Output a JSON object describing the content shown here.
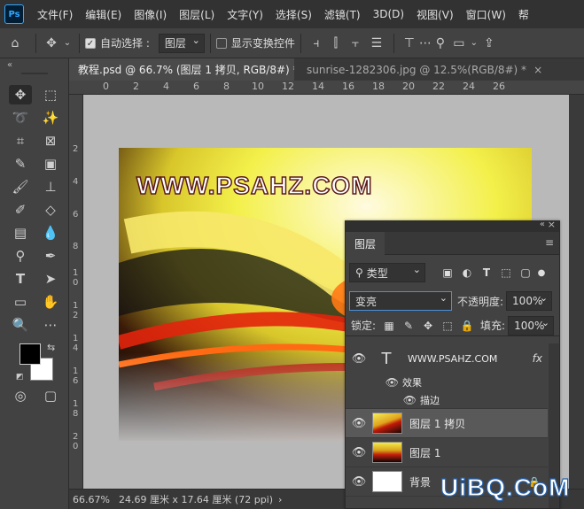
{
  "app": {
    "logo": "Ps"
  },
  "menu": [
    "文件(F)",
    "编辑(E)",
    "图像(I)",
    "图层(L)",
    "文字(Y)",
    "选择(S)",
    "滤镜(T)",
    "3D(D)",
    "视图(V)",
    "窗口(W)",
    "帮"
  ],
  "options": {
    "auto_select_label": "自动选择 :",
    "auto_select_value": "图层",
    "show_transform_label": "显示变换控件"
  },
  "tabs": [
    {
      "label": "教程.psd @ 66.7% (图层 1 拷贝, RGB/8#) *",
      "close": "×"
    },
    {
      "label": "sunrise-1282306.jpg @ 12.5%(RGB/8#) *",
      "close": "×"
    }
  ],
  "ruler_top": [
    "0",
    "2",
    "4",
    "6",
    "8",
    "10",
    "12",
    "14",
    "16",
    "18",
    "20",
    "22",
    "24",
    "26"
  ],
  "ruler_left": [
    "2",
    "4",
    "6",
    "8",
    "1\n0",
    "1\n2",
    "1\n4",
    "1\n6",
    "1\n8",
    "2\n0"
  ],
  "canvas": {
    "watermark_text": "WWW.PSAHZ.COM"
  },
  "status": {
    "zoom": "66.67%",
    "doc_size": "24.69 厘米 x 17.64 厘米 (72 ppi)",
    "arrow": "›"
  },
  "layers_panel": {
    "tab": "图层",
    "filter_kind": "类型",
    "blend_mode": "变亮",
    "opacity_label": "不透明度:",
    "opacity_value": "100%",
    "lock_label": "锁定:",
    "fill_label": "填充:",
    "fill_value": "100%",
    "layers": [
      {
        "name": "WWW.PSAHZ.COM",
        "type": "text",
        "fx": "fx"
      },
      {
        "name": "图层 1 拷贝",
        "type": "image",
        "selected": true
      },
      {
        "name": "图层 1",
        "type": "image"
      },
      {
        "name": "背景",
        "type": "background"
      }
    ],
    "effects_label": "效果",
    "stroke_label": "描边"
  },
  "site_watermark": "UiBQ.CoM"
}
